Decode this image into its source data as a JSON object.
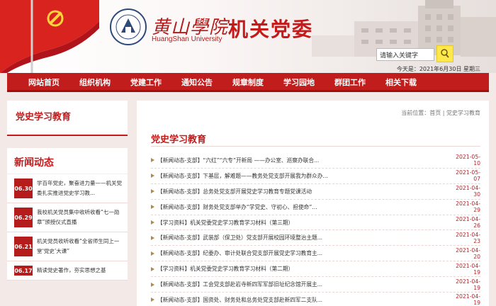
{
  "header": {
    "school_cn": "黄山學院",
    "school_en": "HuangShan University",
    "title": "机关党委",
    "search_placeholder": "请输入关键字",
    "date_text": "今天是：2021年6月30日 星期三"
  },
  "nav": {
    "items": [
      "网站首页",
      "组织机构",
      "党建工作",
      "通知公告",
      "规章制度",
      "学习园地",
      "群团工作",
      "相关下载"
    ]
  },
  "left": {
    "section_title": "党史学习教育",
    "news_title": "新闻动态",
    "news": [
      {
        "date": "06.30",
        "text": "学百年党史，聚奋进力量——机关党委扎实推进党史学习教..."
      },
      {
        "date": "06.29",
        "text": "我校机关党员集中收听收看“七一勋章”颁授仪式直播"
      },
      {
        "date": "06.21",
        "text": "机关党员收听收看“全省师生同上一堂‘党史’大课”"
      },
      {
        "date": "06.17",
        "text": "精读党史著作，夯实思想之基"
      }
    ]
  },
  "main": {
    "breadcrumb": "当前位置：首页 | 党史学习教育",
    "title": "党史学习教育",
    "rows": [
      {
        "title": "【新闻动态-支部】“六红”“六专”开新局 ——办公室、巡察办联合...",
        "date": "2021-05-10"
      },
      {
        "title": "【新闻动态-支部】下基层，解难题——教务处党支部开展我为群众办...",
        "date": "2021-05-07"
      },
      {
        "title": "【新闻动态-支部】总务处党支部开展党史学习教育专题党课活动",
        "date": "2021-04-30"
      },
      {
        "title": "【新闻动态-支部】财务处党支部举办“学党史、守初心、担使命”...",
        "date": "2021-04-29"
      },
      {
        "title": "【学习资料】机关党委党史学习教育学习材料（第三期）",
        "date": "2021-04-26"
      },
      {
        "title": "【新闻动态-支部】武装部（保卫处）党支部开展校园环境整治主题...",
        "date": "2021-04-23"
      },
      {
        "title": "【新闻动态-支部】纪委办、审计处联合党支部开展党史学习教育主...",
        "date": "2021-04-20"
      },
      {
        "title": "【学习资料】机关党委党史学习教育学习材料（第二期）",
        "date": "2021-04-19"
      },
      {
        "title": "【新闻动态-支部】工会党支部赴岩寺新四军军部旧址纪念馆开展主...",
        "date": "2021-04-19"
      },
      {
        "title": "【新闻动态-支部】国资处、财务处和总务处党支部赴新四军二支队...",
        "date": "2021-04-19"
      }
    ]
  },
  "colors": {
    "primary": "#c11d1d",
    "dark_red": "#9d1010",
    "date_red": "#b0272a"
  }
}
